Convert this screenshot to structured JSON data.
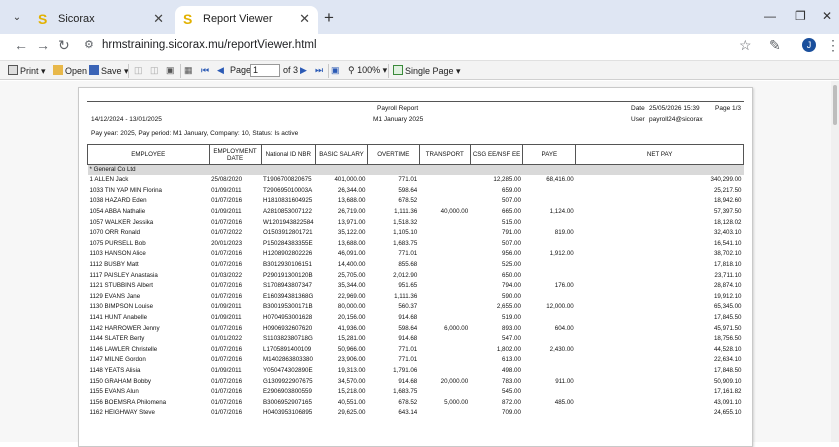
{
  "browser": {
    "tabs": [
      {
        "label": "Sicorax",
        "active": false
      },
      {
        "label": "Report Viewer",
        "active": true
      }
    ],
    "url": "hrmstraining.sicorax.mu/reportViewer.html",
    "avatar_letter": "J"
  },
  "toolbar": {
    "print": "Print",
    "open": "Open",
    "save": "Save",
    "page_label": "Page",
    "page_value": "1",
    "of_pages": "of 3",
    "zoom": "100%",
    "view_mode": "Single Page"
  },
  "report": {
    "date_range": "14/12/2024 - 13/01/2025",
    "title": "Payroll Report",
    "subtitle": "M1 January 2025",
    "date_label": "Date",
    "date_value": "25/05/2026 15:39",
    "page_info": "Page 1/3",
    "user_label": "User",
    "user_value": "payroll24@sicorax",
    "filter_line": "Pay year: 2025, Pay period: M1 January, Company: 10, Status: Is active",
    "columns": [
      "EMPLOYEE",
      "EMPLOYMENT DATE",
      "National ID NBR",
      "BASIC SALARY",
      "OVERTIME",
      "TRANSPORT",
      "CSG EE/NSF EE",
      "PAYE",
      "NET PAY"
    ],
    "group": "* General Co Ltd",
    "rows": [
      [
        "1 ALLEN Jack",
        "25/08/2020",
        "T1906700820675",
        "401,000.00",
        "771.01",
        "",
        "12,285.00",
        "68,416.00",
        "340,299.00"
      ],
      [
        "1033 TIN YAP MIN Florina",
        "01/09/2011",
        "T290695010003A",
        "26,344.00",
        "598.64",
        "",
        "659.00",
        "",
        "25,217.50"
      ],
      [
        "1038 HAZARD Eden",
        "01/07/2016",
        "H1810831604925",
        "13,688.00",
        "678.52",
        "",
        "507.00",
        "",
        "18,942.60"
      ],
      [
        "1054 ABBA Nathalie",
        "01/09/2011",
        "A2810853007122",
        "26,719.00",
        "1,111.36",
        "40,000.00",
        "665.00",
        "1,124.00",
        "57,397.50"
      ],
      [
        "1057 WALKER Jessika",
        "01/07/2016",
        "W1201943822584",
        "13,971.00",
        "1,518.32",
        "",
        "515.00",
        "",
        "18,128.02"
      ],
      [
        "1070 ORR Ronald",
        "01/07/2022",
        "O1503912801721",
        "35,122.00",
        "1,105.10",
        "",
        "791.00",
        "819.00",
        "32,403.10"
      ],
      [
        "1075 PURSELL Bob",
        "20/01/2023",
        "P150284383355E",
        "13,688.00",
        "1,683.75",
        "",
        "507.00",
        "",
        "16,541.10"
      ],
      [
        "1103 HANSON Alice",
        "01/07/2016",
        "H1208902802226",
        "46,091.00",
        "771.01",
        "",
        "956.00",
        "1,912.00",
        "38,702.10"
      ],
      [
        "1112 BUSBY Matt",
        "01/07/2016",
        "B3012930106151",
        "14,400.00",
        "855.68",
        "",
        "525.00",
        "",
        "17,818.10"
      ],
      [
        "1117 PAISLEY Anastasia",
        "01/03/2022",
        "P290191300120B",
        "25,705.00",
        "2,012.90",
        "",
        "650.00",
        "",
        "23,711.10"
      ],
      [
        "1121 STUBBINS Albert",
        "01/07/2016",
        "S1708943807347",
        "35,344.00",
        "951.65",
        "",
        "794.00",
        "176.00",
        "28,874.10"
      ],
      [
        "1129 EVANS Jane",
        "01/07/2016",
        "E160394381368G",
        "22,969.00",
        "1,111.36",
        "",
        "590.00",
        "",
        "19,912.10"
      ],
      [
        "1130 BIMPSON Louise",
        "01/09/2011",
        "B300195300171B",
        "80,000.00",
        "560.37",
        "",
        "2,655.00",
        "12,000.00",
        "65,345.00"
      ],
      [
        "1141 HUNT Anabelle",
        "01/09/2011",
        "H0704953001628",
        "20,156.00",
        "914.68",
        "",
        "519.00",
        "",
        "17,845.50"
      ],
      [
        "1142 HARROWER Jenny",
        "01/07/2016",
        "H0906932607620",
        "41,936.00",
        "598.64",
        "6,000.00",
        "893.00",
        "604.00",
        "45,971.50"
      ],
      [
        "1144 SLATER Berty",
        "01/01/2022",
        "S110382380718G",
        "15,281.00",
        "914.68",
        "",
        "547.00",
        "",
        "18,756.50"
      ],
      [
        "1146 LAWLER Christelle",
        "01/07/2016",
        "L1705891400109",
        "50,966.00",
        "771.01",
        "",
        "1,802.00",
        "2,430.00",
        "44,528.10"
      ],
      [
        "1147 MILNE Gordon",
        "01/07/2016",
        "M1402863803380",
        "23,906.00",
        "771.01",
        "",
        "613.00",
        "",
        "22,634.10"
      ],
      [
        "1148 YEATS Alisia",
        "01/09/2011",
        "Y050474302890E",
        "19,313.00",
        "1,791.06",
        "",
        "498.00",
        "",
        "17,848.50"
      ],
      [
        "1150 GRAHAM Bobby",
        "01/07/2016",
        "G1309922907675",
        "34,570.00",
        "914.68",
        "20,000.00",
        "783.00",
        "911.00",
        "50,909.10"
      ],
      [
        "1155 EVANS Alun",
        "01/07/2016",
        "E2906903800559",
        "15,218.00",
        "1,683.75",
        "",
        "545.00",
        "",
        "17,161.82"
      ],
      [
        "1156 BOEMSRA Philomena",
        "01/07/2016",
        "B3006952907165",
        "40,551.00",
        "678.52",
        "5,000.00",
        "872.00",
        "485.00",
        "43,091.10"
      ],
      [
        "1162 HEIGHWAY Steve",
        "01/07/2016",
        "H0403953106895",
        "29,625.00",
        "643.14",
        "",
        "709.00",
        "",
        "24,655.10"
      ]
    ]
  }
}
